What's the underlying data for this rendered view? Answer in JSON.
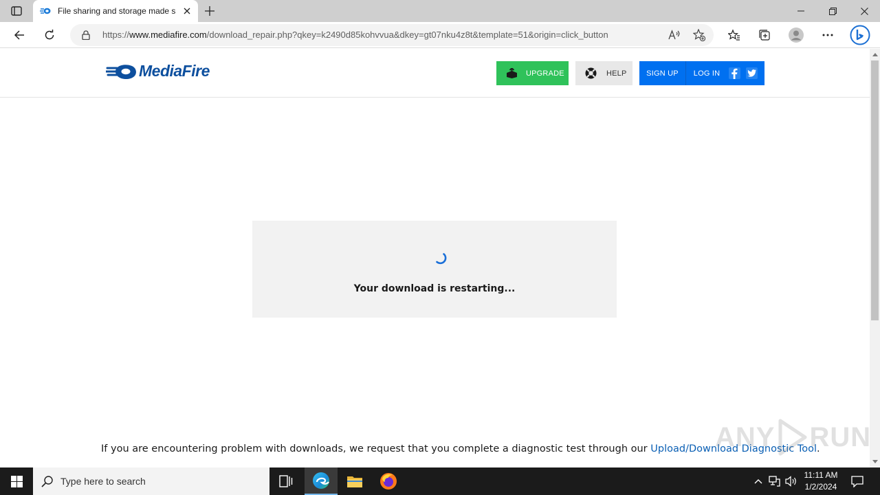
{
  "browser": {
    "tab_title": "File sharing and storage made simple",
    "url_prefix": "https://",
    "url_host": "www.mediafire.com",
    "url_path": "/download_repair.php?qkey=k2490d85kohvvua&dkey=gt07nku4z8t&template=51&origin=click_button"
  },
  "site": {
    "logo_text": "MediaFire",
    "upgrade_label": "UPGRADE",
    "help_label": "HELP",
    "signup_label": "SIGN UP",
    "login_label": "LOG IN"
  },
  "main": {
    "restart_message": "Your download is restarting...",
    "diag_text": "If you are encountering problem with downloads, we request that you complete a diagnostic test through our ",
    "diag_link": "Upload/Download Diagnostic Tool",
    "diag_end": "."
  },
  "watermark": {
    "left": "ANY",
    "right": "RUN"
  },
  "taskbar": {
    "search_placeholder": "Type here to search",
    "time": "11:11 AM",
    "date": "1/2/2024"
  },
  "colors": {
    "brand_blue": "#0d4f9e",
    "upgrade_green": "#2fc25a",
    "auth_blue": "#0070f0",
    "link_blue": "#0a5fb4"
  }
}
